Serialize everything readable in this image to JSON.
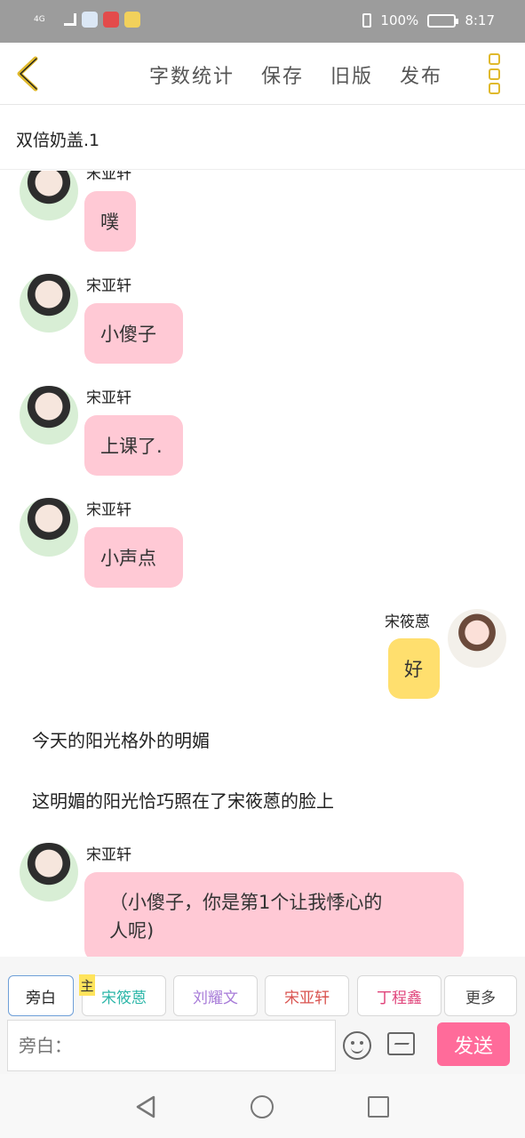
{
  "status_bar": {
    "network": "4G",
    "battery": "100%",
    "time": "8:17",
    "icons": [
      "signal-icon",
      "wifi-icon",
      "app-icon-1",
      "app-icon-2",
      "app-icon-3",
      "vibrate-icon",
      "battery-icon"
    ]
  },
  "toolbar": {
    "word_count": "字数统计",
    "save": "保存",
    "old_version": "旧版",
    "publish": "发布"
  },
  "doc_title": "双倍奶盖.1",
  "messages": [
    {
      "type": "left",
      "name": "宋亚轩",
      "text": "噗"
    },
    {
      "type": "left",
      "name": "宋亚轩",
      "text": "小傻子"
    },
    {
      "type": "left",
      "name": "宋亚轩",
      "text": "上课了."
    },
    {
      "type": "left",
      "name": "宋亚轩",
      "text": "小声点"
    },
    {
      "type": "right",
      "name": "宋筱蒽",
      "text": "好"
    },
    {
      "type": "narration",
      "text": "今天的阳光格外的明媚"
    },
    {
      "type": "narration",
      "text": "这明媚的阳光恰巧照在了宋筱蒽的脸上"
    },
    {
      "type": "left",
      "name": "宋亚轩",
      "text_line1": "（小傻子，你是第1个让我悸心的",
      "text_line2": "人呢)"
    }
  ],
  "roles": {
    "narrator": "旁白",
    "main_badge": "主",
    "role1": "宋筱蒽",
    "role2": "刘耀文",
    "role3": "宋亚轩",
    "role4": "丁程鑫",
    "more": "更多",
    "colors": {
      "role1": "#2bb6a8",
      "role2": "#a77bd8",
      "role3": "#d9534f",
      "role4": "#e0457b"
    }
  },
  "input": {
    "placeholder": "旁白：",
    "send": "发送"
  },
  "colors": {
    "left_bubble": "#ffc9d5",
    "right_bubble": "#ffdf6e",
    "send_button": "#ff6b9a",
    "accent": "#e0b92c"
  }
}
